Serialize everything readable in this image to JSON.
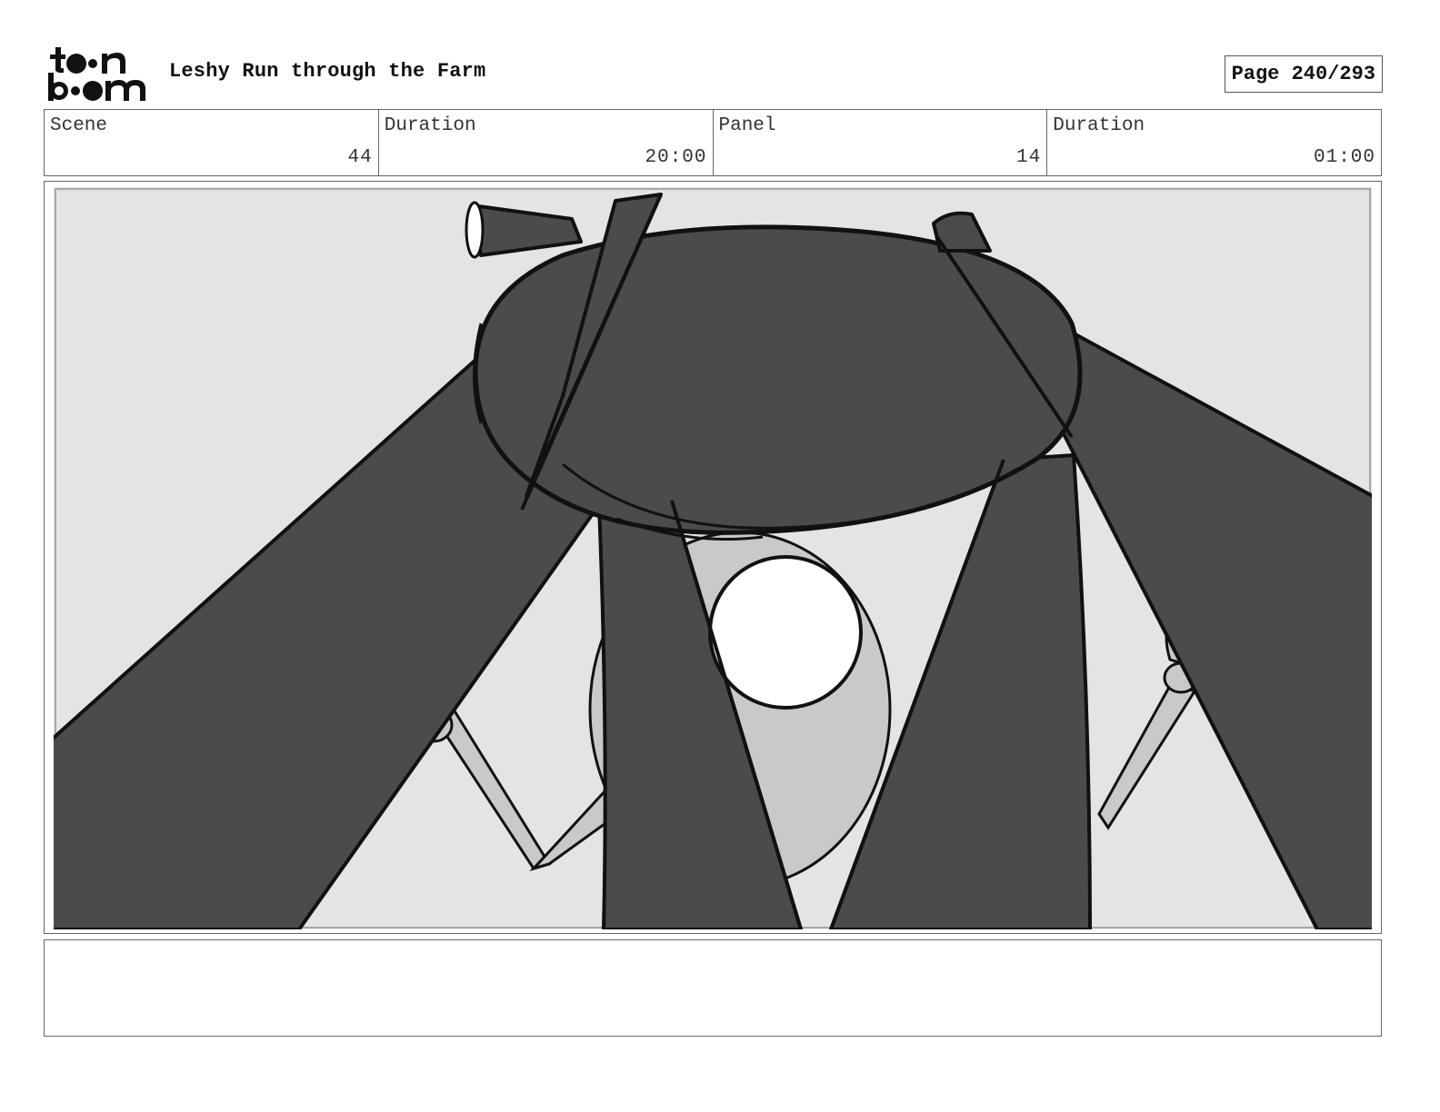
{
  "header": {
    "logo": {
      "icon": "toon-boom-logo",
      "text": "toon boom"
    },
    "title": "Leshy Run through the Farm",
    "page_label": "Page 240/293"
  },
  "info": [
    {
      "label": "Scene",
      "value": "44"
    },
    {
      "label": "Duration",
      "value": "20:00"
    },
    {
      "label": "Panel",
      "value": "14"
    },
    {
      "label": "Duration",
      "value": "01:00"
    }
  ],
  "panel": {
    "image": "storyboard-sketch",
    "colors": {
      "background": "#e4e4e4",
      "dark": "#4b4b4b",
      "mid": "#c9c9c9",
      "light": "#ffffff",
      "line": "#111111"
    }
  },
  "notes": {
    "text": ""
  }
}
